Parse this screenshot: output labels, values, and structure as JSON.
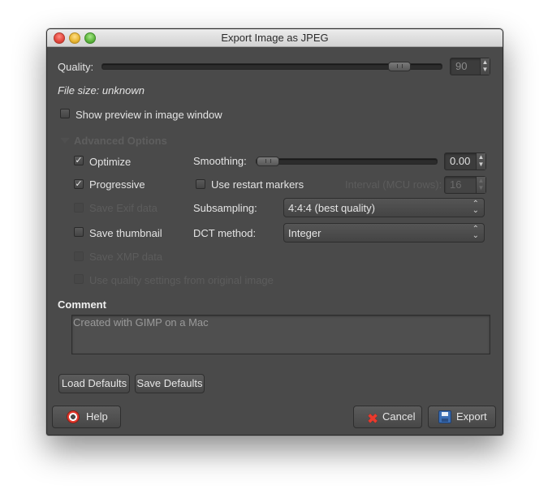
{
  "window": {
    "title": "Export Image as JPEG"
  },
  "quality": {
    "label": "Quality:",
    "value": "90",
    "level": 0.9
  },
  "file_size": "File size: unknown",
  "show_preview": {
    "label": "Show preview in image window",
    "checked": false
  },
  "advanced": {
    "header": "Advanced Options",
    "optimize": {
      "label": "Optimize",
      "checked": true
    },
    "progressive": {
      "label": "Progressive",
      "checked": true
    },
    "save_exif": {
      "label": "Save Exif data",
      "checked": false,
      "disabled": true
    },
    "save_thumbnail": {
      "label": "Save thumbnail",
      "checked": false
    },
    "save_xmp": {
      "label": "Save XMP data",
      "checked": false,
      "disabled": true
    },
    "use_quality_settings": {
      "label": "Use quality settings from original image",
      "checked": false,
      "disabled": true
    },
    "smoothing": {
      "label": "Smoothing:",
      "value": "0.00",
      "level": 0.0
    },
    "restart_markers": {
      "label": "Use restart markers",
      "checked": false
    },
    "interval": {
      "label": "Interval (MCU rows):",
      "value": "16"
    },
    "subsampling": {
      "label": "Subsampling:",
      "value": "4:4:4 (best quality)"
    },
    "dct": {
      "label": "DCT method:",
      "value": "Integer"
    }
  },
  "comment": {
    "label": "Comment",
    "value": "Created with GIMP on a Mac"
  },
  "buttons": {
    "load_defaults": "Load Defaults",
    "save_defaults": "Save Defaults",
    "help": "Help",
    "cancel": "Cancel",
    "export": "Export"
  },
  "icons": {
    "help": "lifebuoy-icon",
    "cancel": "red-x-icon",
    "export": "floppy-disk-icon",
    "expander": "triangle-down-icon"
  }
}
